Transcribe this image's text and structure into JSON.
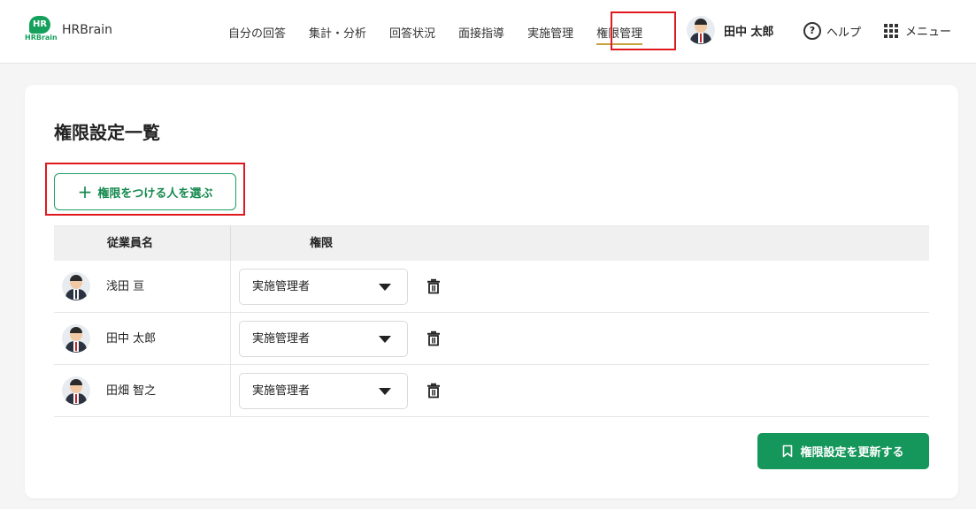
{
  "logo": {
    "mark_text": "HR",
    "small_text": "HRBrain",
    "name": "HRBrain"
  },
  "nav": {
    "items": [
      {
        "label": "自分の回答"
      },
      {
        "label": "集計・分析"
      },
      {
        "label": "回答状況"
      },
      {
        "label": "面接指導"
      },
      {
        "label": "実施管理"
      },
      {
        "label": "権限管理"
      }
    ],
    "active": "権限管理"
  },
  "user": {
    "name": "田中 太郎"
  },
  "help": {
    "icon_text": "?",
    "label": "ヘルプ"
  },
  "menu": {
    "label": "メニュー"
  },
  "page": {
    "title": "権限設定一覧",
    "add_button": {
      "icon": "+",
      "label": "権限をつける人を選ぶ"
    },
    "table": {
      "headers": {
        "employee": "従業員名",
        "permission": "権限"
      },
      "rows": [
        {
          "name": "浅田 亘",
          "role": "実施管理者"
        },
        {
          "name": "田中 太郎",
          "role": "実施管理者"
        },
        {
          "name": "田畑 智之",
          "role": "実施管理者"
        }
      ]
    },
    "update_button": {
      "label": "権限設定を更新する"
    }
  },
  "colors": {
    "brand_green": "#15965a",
    "highlight_red": "#e0191f",
    "active_underline": "#c8a03c"
  },
  "icons": [
    "help-icon",
    "grid-menu-icon",
    "plus-icon",
    "caret-down-icon",
    "trash-icon",
    "bookmark-icon"
  ]
}
